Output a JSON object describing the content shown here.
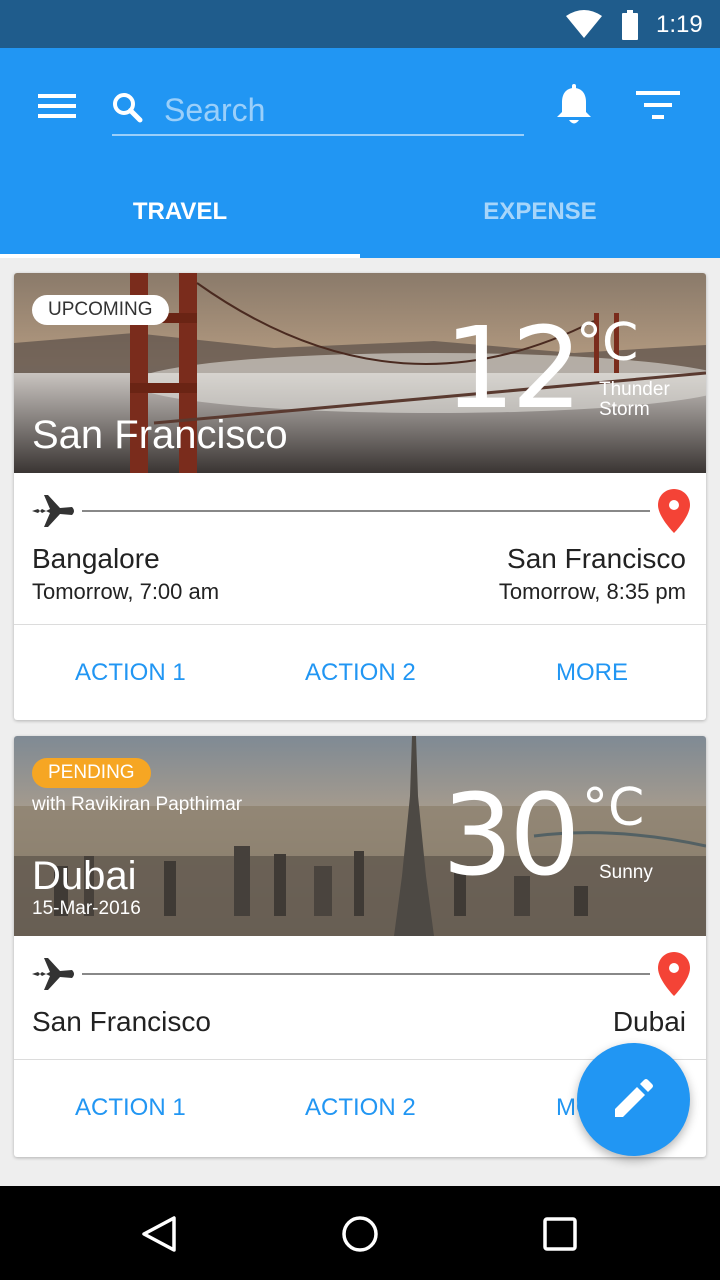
{
  "status_bar": {
    "time": "1:19",
    "icons": [
      "wifi-icon",
      "battery-icon"
    ]
  },
  "app_bar": {
    "search": {
      "placeholder": "Search",
      "value": ""
    },
    "icons": [
      "menu-icon",
      "search-icon",
      "bell-icon",
      "filter-icon"
    ]
  },
  "tabs": [
    {
      "label": "TRAVEL",
      "selected": true
    },
    {
      "label": "EXPENSE",
      "selected": false
    }
  ],
  "trips": [
    {
      "status": "UPCOMING",
      "city": "San Francisco",
      "temperature": "12",
      "unit": "°C",
      "condition": "Thunder Storm",
      "from": {
        "city": "Bangalore",
        "time": "Tomorrow, 7:00 am"
      },
      "to": {
        "city": "San Francisco",
        "time": "Tomorrow, 8:35 pm"
      },
      "actions": [
        "ACTION 1",
        "ACTION 2",
        "MORE"
      ]
    },
    {
      "status": "PENDING",
      "with": "with Ravikiran Papthimar",
      "city": "Dubai",
      "date": "15-Mar-2016",
      "temperature": "30",
      "unit": "°C",
      "condition": "Sunny",
      "from": {
        "city": "San Francisco"
      },
      "to": {
        "city": "Dubai"
      },
      "actions": [
        "ACTION 1",
        "ACTION 2",
        "MORE"
      ]
    }
  ],
  "colors": {
    "primary": "#2196f3",
    "status_bar": "#1f5c8c",
    "pending": "#f6a623",
    "pin": "#f44336"
  }
}
